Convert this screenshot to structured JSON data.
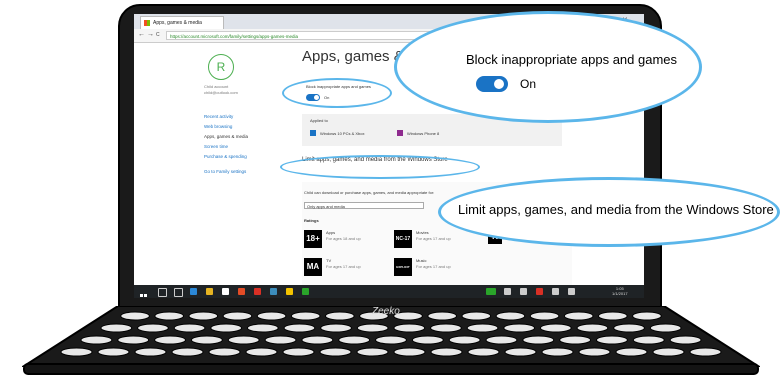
{
  "browser": {
    "tab_title": "Apps, games & media",
    "url": "https://account.microsoft.com/family/settings/apps-games-media",
    "controls": [
      "—",
      "□",
      "✕"
    ],
    "nav": [
      "←",
      "→",
      "C"
    ]
  },
  "sidebar": {
    "avatar_letter": "R",
    "user_line1": "Child account",
    "user_line2": "child@outlook.com",
    "links": [
      "Recent activity",
      "Web browsing",
      "Apps, games & media",
      "Screen time",
      "Purchase & spending",
      "Go to Family settings"
    ]
  },
  "page": {
    "title": "Apps, games & media",
    "block_small_label": "Block inappropriate apps and games",
    "toggle_small_state": "On",
    "applied_to_label": "Applied to",
    "devices": [
      "Windows 10 PCs & Xbox",
      "Windows Phone 8"
    ],
    "limit_small_label": "Limit apps, games, and media from the Windows Store",
    "age_label": "Child can download or purchase apps, games, and media appropriate for:",
    "age_value": "Only apps and media",
    "ratings_label": "Ratings",
    "ratings": [
      {
        "icon": "18+",
        "title": "Apps",
        "desc": "For ages 18 and up"
      },
      {
        "icon": "NC-17",
        "title": "Movies",
        "desc": "For ages 17 and up"
      },
      {
        "icon": "R",
        "title": "",
        "desc": "For ages 17 and up"
      },
      {
        "icon": "MA",
        "title": "TV",
        "desc": "For ages 17 and up"
      },
      {
        "icon": "EXPLICIT",
        "title": "Music",
        "desc": "For ages 17 and up"
      }
    ]
  },
  "taskbar": {
    "clock": "1:05",
    "date": "1/1/2017"
  },
  "laptop": {
    "brand": "Zeeko"
  },
  "callouts": {
    "block_label": "Block inappropriate apps and games",
    "toggle_state": "On",
    "limit_label": "Limit apps, games, and media from the Windows Store"
  },
  "colors": {
    "callout": "#5bb6ea",
    "toggle": "#1a73c5",
    "bezel": "#1a1a1a"
  }
}
